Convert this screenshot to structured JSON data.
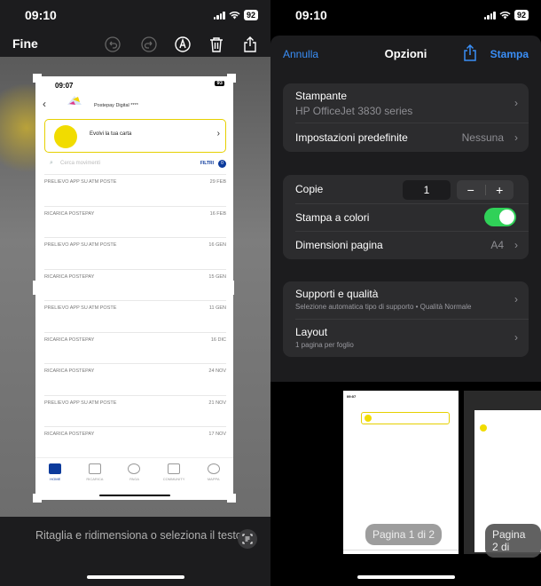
{
  "left": {
    "status": {
      "time": "09:10",
      "battery": "92"
    },
    "toolbar": {
      "done_label": "Fine"
    },
    "screenshot": {
      "status_time": "09:07",
      "battery": "93",
      "account_name": "Postepay Digital ****",
      "promo_text": "Evolvi la tua carta",
      "search_placeholder": "Cerca movimenti",
      "filter_label": "FILTRI",
      "filter_count": "0",
      "transactions": [
        {
          "desc": "PRELIEVO APP SU ATM POSTE",
          "date": "29 FEB"
        },
        {
          "desc": "RICARICA POSTEPAY",
          "date": "16 FEB"
        },
        {
          "desc": "PRELIEVO APP SU ATM POSTE",
          "date": "16 GEN"
        },
        {
          "desc": "RICARICA POSTEPAY",
          "date": "15 GEN"
        },
        {
          "desc": "PRELIEVO APP SU ATM POSTE",
          "date": "11 GEN"
        },
        {
          "desc": "RICARICA POSTEPAY",
          "date": "16 DIC"
        },
        {
          "desc": "RICARICA POSTEPAY",
          "date": "24 NOV"
        },
        {
          "desc": "PRELIEVO APP SU ATM POSTE",
          "date": "21 NOV"
        },
        {
          "desc": "RICARICA POSTEPAY",
          "date": "17 NOV"
        }
      ],
      "tabs": [
        "HOME",
        "RICARICA",
        "PAGA",
        "COMMUNITY",
        "MAPPA"
      ]
    },
    "hint": "Ritaglia e ridimensiona o seleziona il testo"
  },
  "right": {
    "status": {
      "time": "09:10",
      "battery": "92"
    },
    "nav": {
      "cancel": "Annulla",
      "title": "Opzioni",
      "print": "Stampa"
    },
    "printer": {
      "label": "Stampante",
      "value": "HP OfficeJet 3830 series"
    },
    "presets": {
      "label": "Impostazioni predefinite",
      "value": "Nessuna"
    },
    "copies": {
      "label": "Copie",
      "value": "1",
      "minus": "−",
      "plus": "+"
    },
    "color": {
      "label": "Stampa a colori",
      "on": true
    },
    "paper": {
      "label": "Dimensioni pagina",
      "value": "A4"
    },
    "media": {
      "label": "Supporti e qualità",
      "sub": "Selezione automatica tipo di supporto • Qualità Normale"
    },
    "layout": {
      "label": "Layout",
      "sub": "1 pagina per foglio"
    },
    "previews": [
      "Pagina 1 di 2",
      "Pagina 2 di"
    ],
    "accent": "#3a8ef6",
    "toggle_color": "#30d158"
  }
}
